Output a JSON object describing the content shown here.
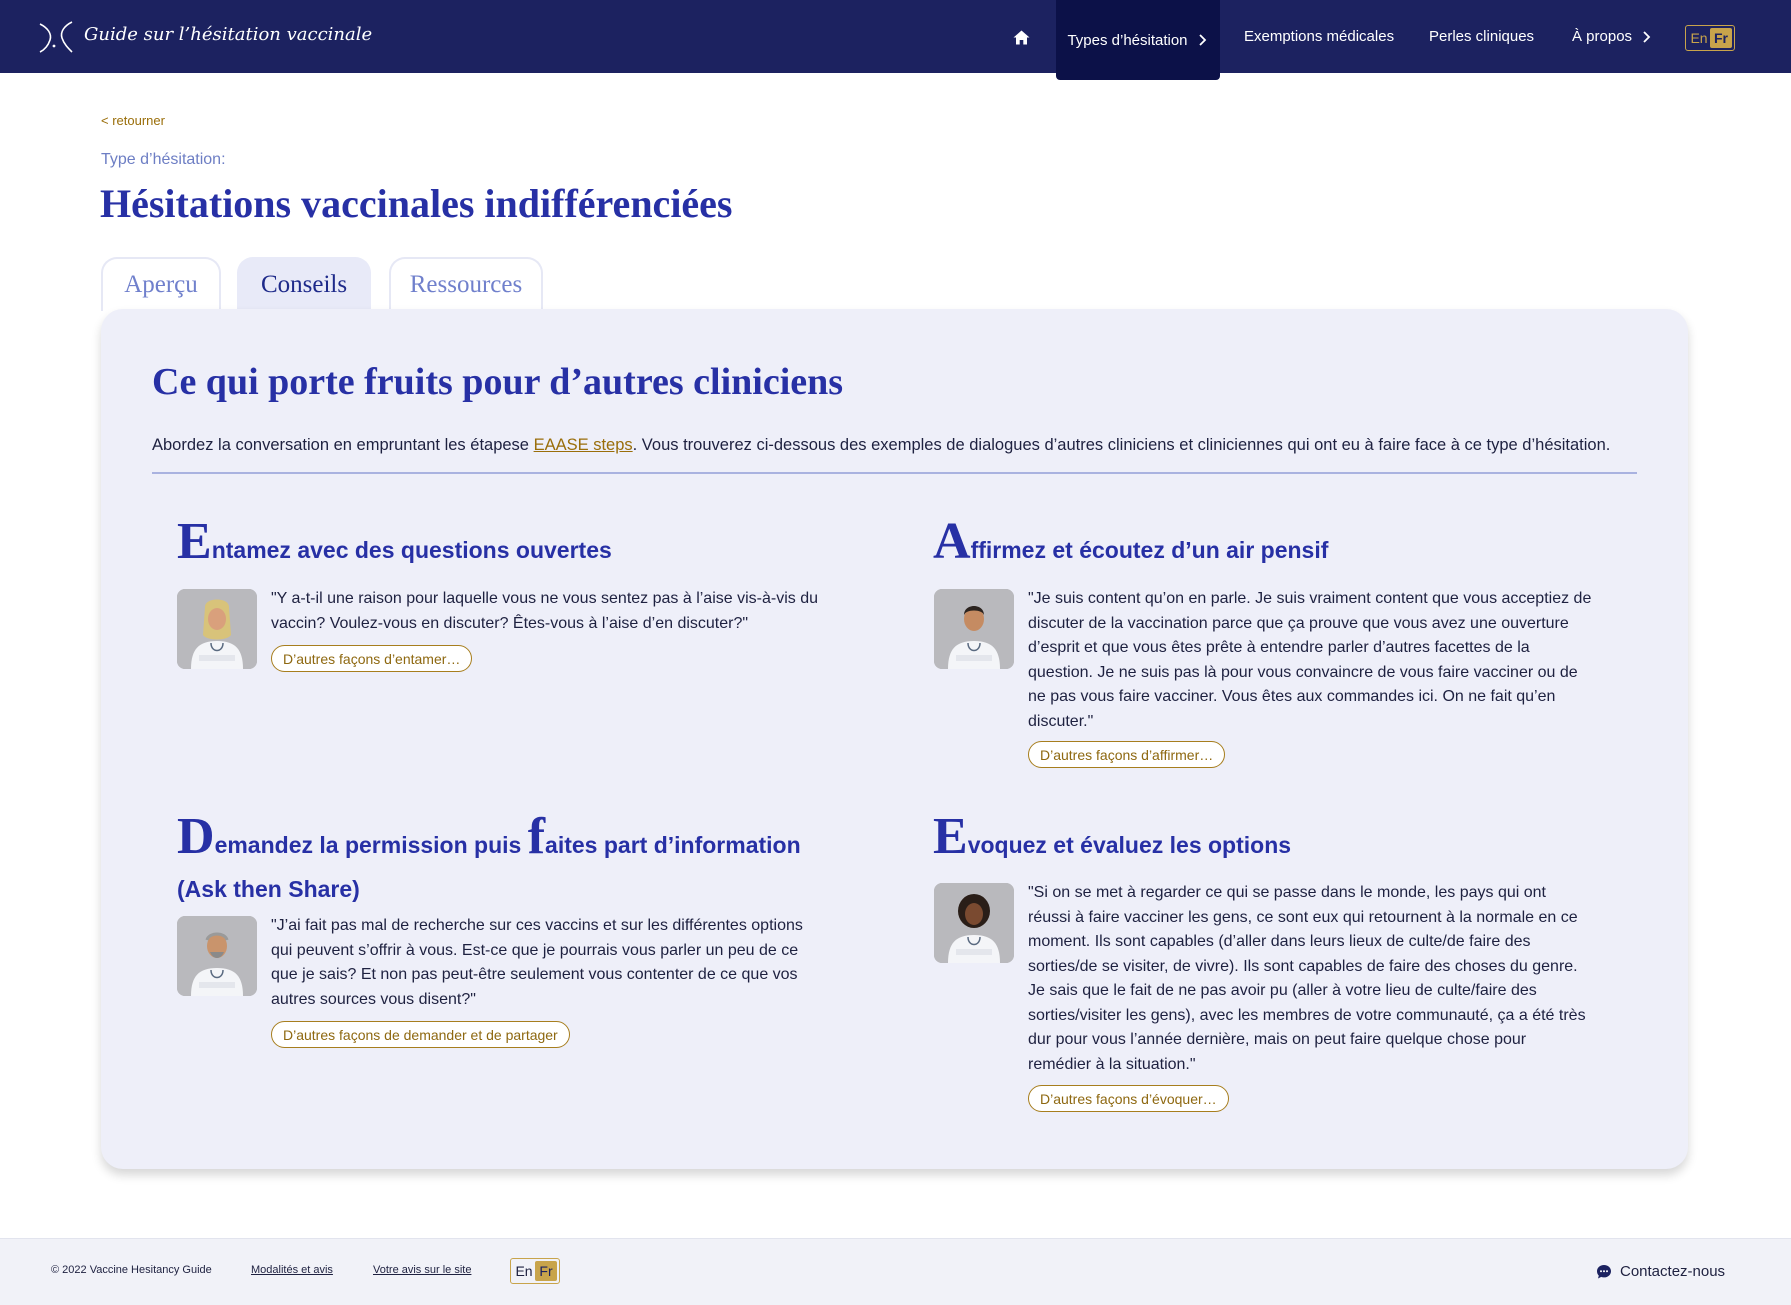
{
  "header": {
    "site_title": "Guide sur l’hésitation vaccinale",
    "nav": {
      "types": "Types d’hésitation",
      "exemptions": "Exemptions médicales",
      "perles": "Perles cliniques",
      "apropos": "À propos"
    },
    "lang": {
      "en": "En",
      "fr": "Fr",
      "active": "Fr"
    }
  },
  "page": {
    "back": "< retourner",
    "type_label": "Type d’hésitation:",
    "title": "Hésitations vaccinales indifférenciées"
  },
  "tabs": [
    {
      "label": "Aperçu",
      "active": false
    },
    {
      "label": "Conseils",
      "active": true
    },
    {
      "label": "Ressources",
      "active": false
    }
  ],
  "panel": {
    "title": "Ce qui porte fruits pour d’autres cliniciens",
    "intro_before": "Abordez la conversation en empruntant les étapese ",
    "intro_link": "EAASE steps",
    "intro_after": ". Vous trouverez ci-dessous des exemples de dialogues d’autres cliniciens et cliniciennes qui ont eu à faire face à ce type d’hésitation.",
    "steps": [
      {
        "big": "E",
        "heading": "ntamez avec des questions ouvertes",
        "quote": "\"Y a-t-il une raison pour laquelle vous ne vous sentez pas à l’aise vis-à-vis du vaccin? Voulez-vous en discuter? Êtes-vous à l’aise d’en discuter?\"",
        "button": "D’autres façons d’entamer…"
      },
      {
        "big": "A",
        "heading": "ffirmez et écoutez d’un air pensif",
        "quote": "\"Je suis content qu’on en parle. Je suis vraiment content que vous acceptiez de discuter de la vaccination parce que ça prouve que vous avez une ouverture d’esprit et que vous êtes prête à entendre parler d’autres facettes de la question. Je ne suis pas là pour vous convaincre de vous faire vacciner ou de ne pas vous faire vacciner. Vous êtes aux commandes ici. On ne fait qu’en discuter.\"",
        "button": "D’autres façons d’affirmer…"
      },
      {
        "big": "D",
        "heading_a": "emandez la permission puis ",
        "big2": "f",
        "heading_b": "aites part d’information (",
        "bold_a": "A",
        "heading_c": "sk then ",
        "bold_s": "S",
        "heading_d": "hare)",
        "quote": "\"J’ai fait pas mal de recherche sur ces vaccins et sur les différentes options qui peuvent s’offrir à vous. Est-ce que je pourrais vous parler un peu de ce que je sais? Et non pas peut-être seulement vous contenter de ce que vos autres sources vous disent?\"",
        "button": "D’autres façons de demander et de partager"
      },
      {
        "big": "E",
        "heading": "voquez et évaluez les options",
        "quote": "\"Si on se met à regarder ce qui se passe dans le monde, les pays qui ont réussi à faire vacciner les gens, ce sont eux qui retournent à la normale en ce moment. Ils sont capables (d’aller dans leurs lieux de culte/de faire des sorties/de se visiter, de vivre). Ils sont capables de faire des choses du genre. Je sais que le fait de ne pas avoir pu (aller à votre lieu de culte/faire des sorties/visiter les gens), avec les membres de votre communauté, ça a été très dur pour vous l’année dernière, mais on peut faire quelque chose pour remédier à la situation.\"",
        "button": "D’autres façons d’évoquer…"
      }
    ]
  },
  "footer": {
    "copyright": "© 2022 Vaccine Hesitancy Guide",
    "terms": "Modalités et avis",
    "feedback": "Votre avis sur le site",
    "lang": {
      "en": "En",
      "fr": "Fr"
    },
    "contact": "Contactez-nous"
  },
  "colors": {
    "navy": "#1c2260",
    "accent_blue": "#2730a5",
    "gold": "#c8a44b",
    "panel_bg": "#eeeff9"
  },
  "icons": {
    "logo": "vaccine-guide-logo-icon",
    "home": "home-icon",
    "chevron": "chevron-right-icon",
    "chat": "chat-bubble-icon",
    "avatars": [
      "clinician-hijab-avatar",
      "clinician-male-avatar",
      "clinician-older-male-avatar",
      "clinician-female-avatar"
    ]
  }
}
